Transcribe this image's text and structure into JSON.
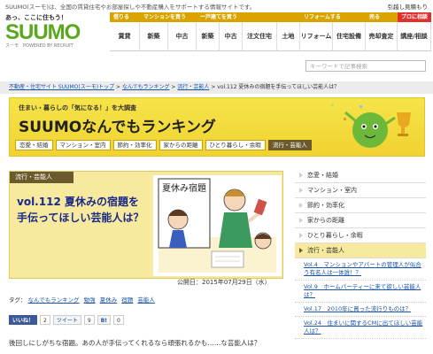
{
  "topbar": {
    "description": "SUUMO(スーモ)は、全国の賃貸住宅やお部屋探しや不動産購入をサポートする情報サイトです。",
    "move_link": "引越し見積もり"
  },
  "logo": {
    "tagline": "あっ、ここに住もう！",
    "word": "SUUMO",
    "sub": "スーモ　POWERED BY RECRUIT"
  },
  "nav": {
    "groups": [
      {
        "header": "借りる",
        "items": [
          "賃貸"
        ]
      },
      {
        "header": "マンションを買う",
        "items": [
          "新築",
          "中古"
        ]
      },
      {
        "header": "一戸建てを買う",
        "items": [
          "新築",
          "中古",
          "注文住宅",
          "土地"
        ]
      },
      {
        "header": "リフォームする",
        "items": [
          "リフォーム",
          "住宅設備"
        ]
      },
      {
        "header": "売る",
        "items": [
          "売却査定"
        ]
      },
      {
        "header": "プロに相談",
        "items": [
          "講座/相談"
        ]
      }
    ]
  },
  "search": {
    "placeholder": "キーワードで記事検索"
  },
  "breadcrumb": {
    "items": [
      "不動産・住宅サイト SUUMO(スーモ)トップ",
      "なんでもランキング",
      "流行・芸能人"
    ],
    "current": "vol.112 夏休みの宿題を手伝ってほしい芸能人は？",
    "sep": ">"
  },
  "banner": {
    "kicker": "住まい・暮らしの「気になる！」を大調査",
    "title": "SUUMOなんでもランキング",
    "tabs": [
      "恋愛・結婚",
      "マンション・室内",
      "節約・効率化",
      "家からの距離",
      "ひとり暮らし・余暇",
      "流行・芸能人"
    ],
    "active_tab": 5
  },
  "article": {
    "category": "流行・芸能人",
    "title": "vol.112 夏休みの宿題を手伝ってほしい芸能人は？",
    "illustration_sign": "夏休み宿題",
    "date": "公開日：2015年07月29日（水）"
  },
  "tags": {
    "label": "タグ：",
    "items": [
      "なんでもランキング",
      "勉強",
      "夏休み",
      "宿題",
      "芸能人"
    ]
  },
  "social": {
    "like": "いいね！",
    "like_count": "2",
    "tweet": "ツイート",
    "tweet_count": "9",
    "hatena": "B!",
    "hatena_count": "0"
  },
  "intro": "後回しにしがちな宿題。あの人が手伝ってくれるなら頑張れるかも……な芸能人は？",
  "sidebar": {
    "categories": [
      "恋愛・結婚",
      "マンション・室内",
      "節約・効率化",
      "家からの距離",
      "ひとり暮らし・余暇",
      "流行・芸能人"
    ],
    "active": 5,
    "links": [
      "Vol.4　マンションやアパートの管理人が似合う有名人は一体誰！？",
      "Vol.9　ホームパーティーに来て欲しい芸能人は？",
      "Vol.17　2010年に買った流行りものは？",
      "Vol.24　住まいに関するCMに出てほしい芸能人は？"
    ]
  },
  "colors": {
    "brand_green": "#5aa81e",
    "nav_gold": "#d9a400",
    "nav_red": "#e0302c",
    "banner_yellow": "#f1d230",
    "category_brown": "#6b5a2b",
    "link_blue": "#1a55a8"
  }
}
